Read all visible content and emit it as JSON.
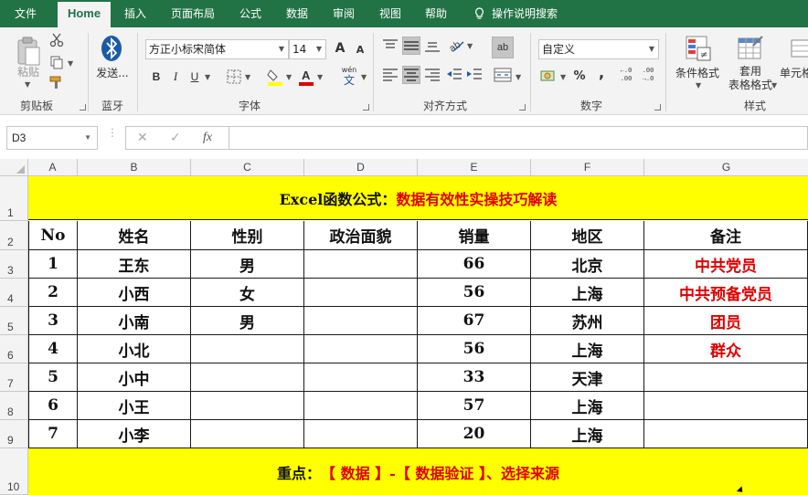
{
  "tabs": [
    {
      "label": "文件",
      "active": false
    },
    {
      "label": "Home",
      "active": true
    },
    {
      "label": "插入",
      "active": false
    },
    {
      "label": "页面布局",
      "active": false
    },
    {
      "label": "公式",
      "active": false
    },
    {
      "label": "数据",
      "active": false
    },
    {
      "label": "审阅",
      "active": false
    },
    {
      "label": "视图",
      "active": false
    },
    {
      "label": "帮助",
      "active": false
    }
  ],
  "tell_me": "操作说明搜索",
  "ribbon": {
    "clipboard": {
      "paste_label": "粘贴",
      "group_label": "剪贴板"
    },
    "bluetooth": {
      "send_label": "发送...",
      "group_label": "蓝牙"
    },
    "font": {
      "font_name": "方正小标宋简体",
      "font_size": "14",
      "grow_glyph": "A",
      "shrink_glyph": "A",
      "bold": "B",
      "italic": "I",
      "underline": "U",
      "wen_glyph": "wén",
      "wen_char": "文",
      "group_label": "字体"
    },
    "alignment": {
      "group_label": "对齐方式",
      "wrap_glyph": "ab"
    },
    "number": {
      "format": "自定义",
      "percent": "%",
      "comma": ",",
      "inc_decimal": "←.0 .00",
      "dec_decimal": ".00 →.0",
      "group_label": "数字"
    },
    "styles": {
      "conditional": "条件格式",
      "table_format_1": "套用",
      "table_format_2": "表格格式",
      "cell_styles": "单元格",
      "group_label": "样式"
    }
  },
  "formula_bar": {
    "name_box": "D3",
    "cancel": "✕",
    "confirm": "✓",
    "fx": "fx",
    "formula": ""
  },
  "sheet": {
    "columns": [
      "A",
      "B",
      "C",
      "D",
      "E",
      "F",
      "G"
    ],
    "rows": [
      "1",
      "2",
      "3",
      "4",
      "5",
      "6",
      "7",
      "8",
      "9",
      "10"
    ],
    "title": {
      "black": "Excel函数公式：",
      "red": "数据有效性实操技巧解读"
    },
    "headers": [
      "No",
      "姓名",
      "性别",
      "政治面貌",
      "销量",
      "地区",
      "备注"
    ],
    "data": [
      [
        "1",
        "王东",
        "男",
        "",
        "66",
        "北京",
        "中共党员"
      ],
      [
        "2",
        "小西",
        "女",
        "",
        "56",
        "上海",
        "中共预备党员"
      ],
      [
        "3",
        "小南",
        "男",
        "",
        "67",
        "苏州",
        "团员"
      ],
      [
        "4",
        "小北",
        "",
        "",
        "56",
        "上海",
        "群众"
      ],
      [
        "5",
        "小中",
        "",
        "",
        "33",
        "天津",
        ""
      ],
      [
        "6",
        "小王",
        "",
        "",
        "57",
        "上海",
        ""
      ],
      [
        "7",
        "小李",
        "",
        "",
        "20",
        "上海",
        ""
      ]
    ],
    "footer": {
      "black": "重点：",
      "red": "【 数据 】-【 数据验证 】、选择来源"
    },
    "colors": {
      "banner": "#ffff00",
      "accent": "#e00000",
      "ribbon": "#217346"
    }
  }
}
